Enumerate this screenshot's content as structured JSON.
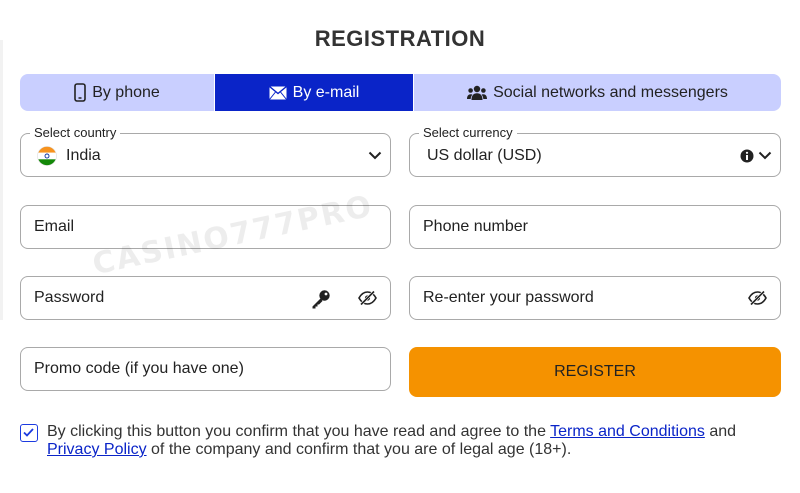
{
  "page": {
    "title": "REGISTRATION",
    "watermark": "CASINO777PRO"
  },
  "tabs": [
    {
      "label": "By phone",
      "icon": "smartphone-icon",
      "active": false
    },
    {
      "label": "By e-mail",
      "icon": "envelope-icon",
      "active": true
    },
    {
      "label": "Social networks and messengers",
      "icon": "users-icon",
      "active": false
    }
  ],
  "form": {
    "country": {
      "legend": "Select country",
      "value": "India",
      "icon": "india-flag-icon"
    },
    "currency": {
      "legend": "Select currency",
      "value": "US dollar (USD)",
      "icon": "info-icon"
    },
    "email": {
      "placeholder": "Email"
    },
    "phone": {
      "placeholder": "Phone number"
    },
    "password": {
      "placeholder": "Password",
      "icons": [
        "key-icon",
        "eye-slash-icon"
      ]
    },
    "repassword": {
      "placeholder": "Re-enter your password",
      "icons": [
        "eye-slash-icon"
      ]
    },
    "promo": {
      "placeholder": "Promo code (if you have one)"
    },
    "register_label": "REGISTER"
  },
  "consent": {
    "checked": true,
    "text_before": "By clicking this button you confirm that you have read and agree to the ",
    "terms_link": "Terms and Conditions",
    "text_middle": " and ",
    "privacy_link": "Privacy Policy",
    "text_after": " of the company and confirm that you are of legal age (18+)."
  },
  "colors": {
    "tab_active": "#0a24c8",
    "tab_inactive": "#c9cfff",
    "register_button": "#f59200",
    "link": "#0a24c8"
  }
}
